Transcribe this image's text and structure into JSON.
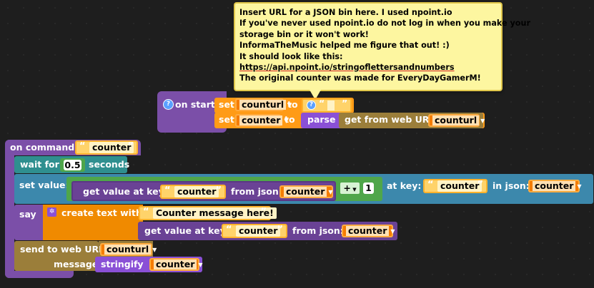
{
  "comment": {
    "lines": [
      "Insert URL for a JSON bin here. I used npoint.io",
      "If you've never used npoint.io do not log in when you make your",
      "storage bin or it won't work!",
      "InformaTheMusic helped me figure that out! :)",
      "It should look like this:",
      "https://api.npoint.io/stringoflettersandnumbers",
      "The original counter was made for EveryDayGamerM!"
    ]
  },
  "on_start": {
    "title": "on start",
    "set1": {
      "set": "set",
      "var": "counturl",
      "to": "to",
      "value": ""
    },
    "set2": {
      "set": "set",
      "var": "counter",
      "to": "to",
      "parse": "parse",
      "get": "get from web URL",
      "arg": "counturl"
    }
  },
  "on_command": {
    "title": "on command",
    "command": "counter",
    "wait": {
      "label": "wait for",
      "value": "0.5",
      "unit": "seconds"
    },
    "set_value": {
      "label": "set value:",
      "get_label": "get value at key:",
      "get_key": "counter",
      "from_json": "from json:",
      "from_var": "counter",
      "op": "+",
      "operand": "1",
      "at_key": "at key:",
      "at_key_value": "counter",
      "in_json": "in json:",
      "in_json_var": "counter"
    },
    "say": {
      "label": "say",
      "create": "create text with",
      "message": "Counter message here!",
      "get_label": "get value at key:",
      "get_key": "counter",
      "from_json": "from json:",
      "from_var": "counter"
    },
    "send": {
      "label": "send to web URL",
      "url_var": "counturl",
      "message_label": "message",
      "stringify": "stringify",
      "stringify_var": "counter"
    }
  }
}
